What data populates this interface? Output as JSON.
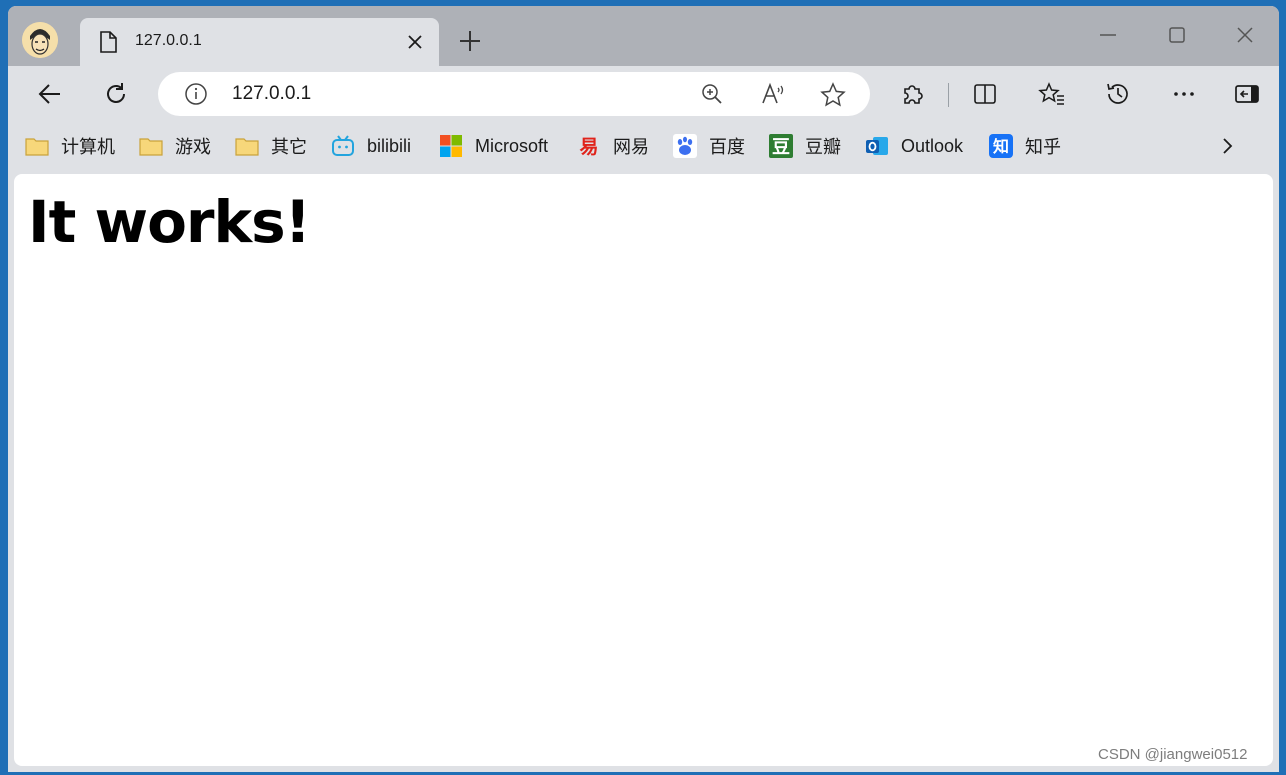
{
  "tab": {
    "title": "127.0.0.1"
  },
  "address_bar": {
    "url": "127.0.0.1"
  },
  "bookmarks": [
    {
      "label": "计算机",
      "icon": "folder-icon"
    },
    {
      "label": "游戏",
      "icon": "folder-icon"
    },
    {
      "label": "其它",
      "icon": "folder-icon"
    },
    {
      "label": "bilibili",
      "icon": "bilibili-icon"
    },
    {
      "label": "Microsoft",
      "icon": "microsoft-icon"
    },
    {
      "label": "网易",
      "icon": "netease-icon"
    },
    {
      "label": "百度",
      "icon": "baidu-icon"
    },
    {
      "label": "豆瓣",
      "icon": "douban-icon"
    },
    {
      "label": "Outlook",
      "icon": "outlook-icon"
    },
    {
      "label": "知乎",
      "icon": "zhihu-icon"
    }
  ],
  "page": {
    "heading": "It works!"
  },
  "watermark": "CSDN @jiangwei0512",
  "colors": {
    "frame": "#1f6fb6",
    "titlebar": "#aeb1b7",
    "toolbar": "#dfe1e5",
    "content": "#ffffff",
    "folder": "#f3c75f"
  }
}
